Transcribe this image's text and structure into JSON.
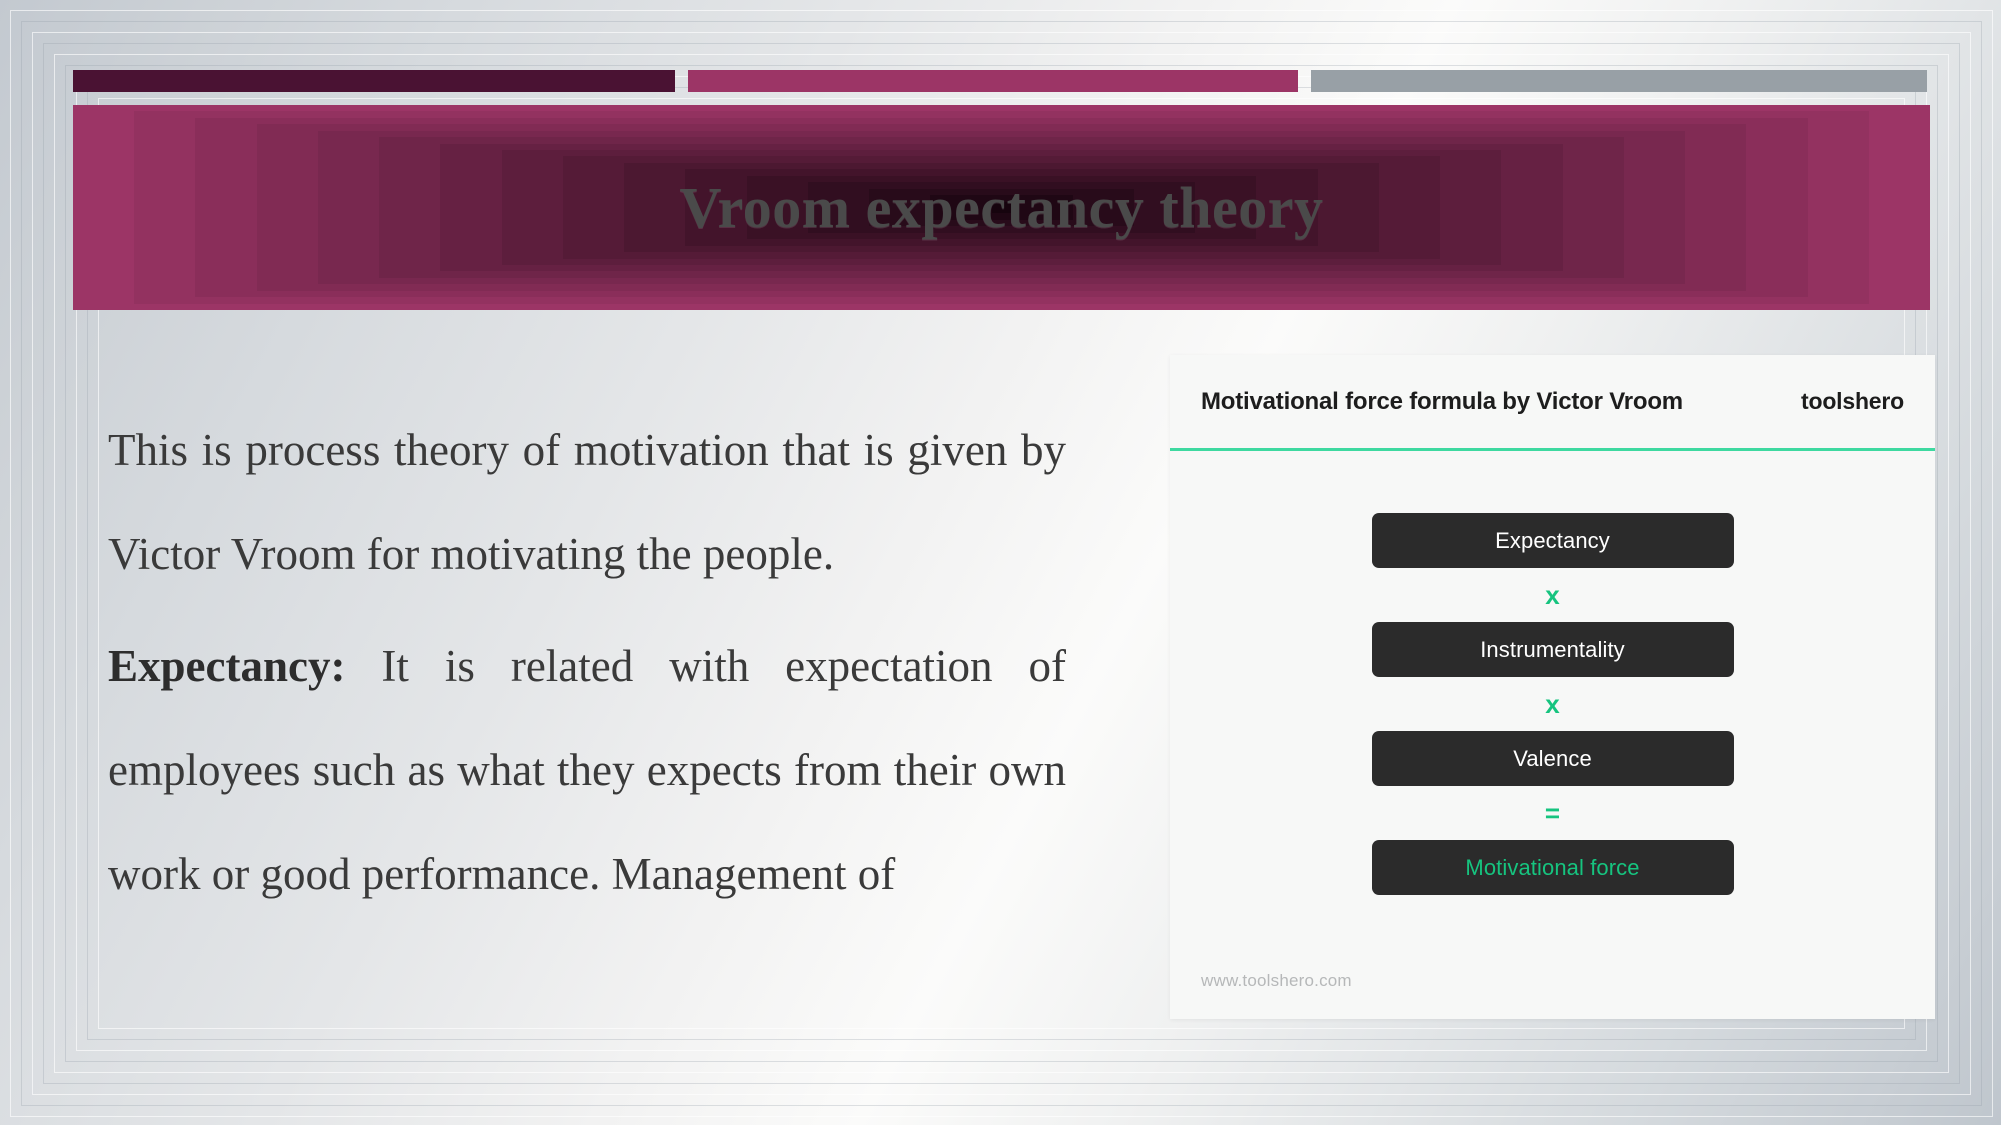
{
  "slide": {
    "title": "Vroom expectancy theory",
    "accent_plum": "#4a1233",
    "accent_pink": "#9c3566",
    "accent_grey": "#98a0a6",
    "title_color": "#4a4a4a"
  },
  "topbar": {
    "segments": [
      {
        "name": "segment-plum",
        "color": "#4a1233"
      },
      {
        "name": "segment-pink",
        "color": "#9c3566"
      },
      {
        "name": "segment-grey",
        "color": "#98a0a6"
      }
    ]
  },
  "body": {
    "paragraph_1": "This is process theory of motivation that is given by Victor Vroom for motivating the people.",
    "paragraph_2_label": "Expectancy:",
    "paragraph_2_text": " It is related with expectation of employees such as what they expects from their own work or good performance. Management of"
  },
  "toolshero_card": {
    "title": "Motivational force formula by Victor Vroom",
    "brand": "toolshero",
    "footer_url": "www.toolshero.com",
    "accent_green": "#16c47f",
    "rule_green": "#3ed9a0",
    "box_color": "#2b2b2b",
    "card_bg": "#f7f8f7",
    "rows": [
      {
        "type": "box",
        "label": "Expectancy",
        "highlight": false
      },
      {
        "type": "operator",
        "label": "x"
      },
      {
        "type": "box",
        "label": "Instrumentality",
        "highlight": false
      },
      {
        "type": "operator",
        "label": "x"
      },
      {
        "type": "box",
        "label": "Valence",
        "highlight": false
      },
      {
        "type": "operator",
        "label": "="
      },
      {
        "type": "box",
        "label": "Motivational force",
        "highlight": true
      }
    ]
  }
}
